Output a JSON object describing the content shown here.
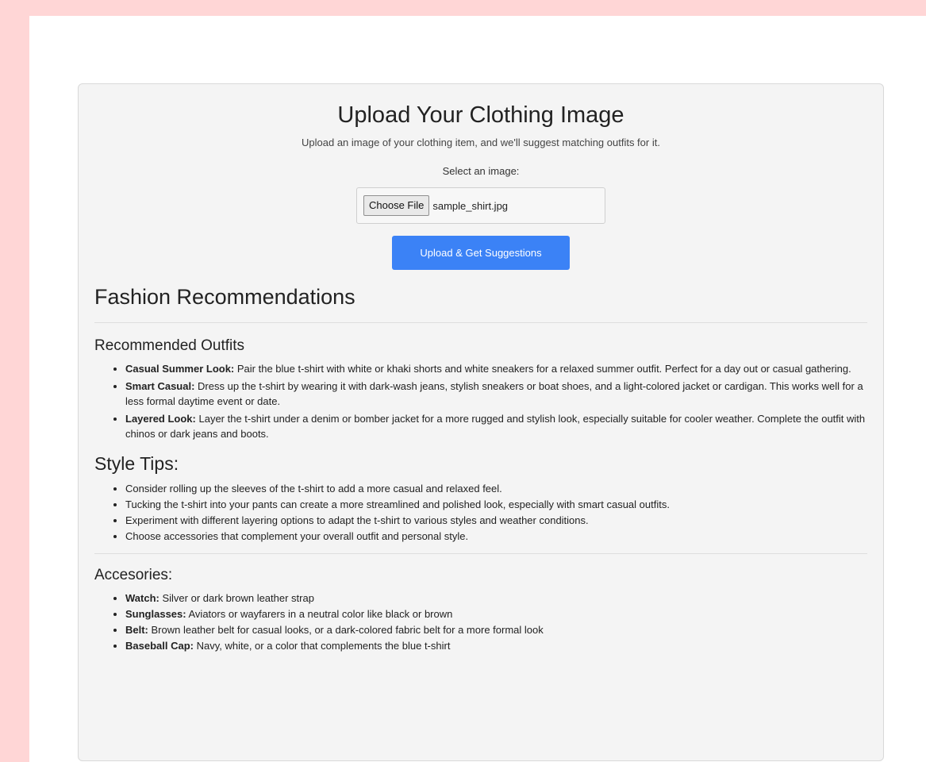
{
  "upload": {
    "title": "Upload Your Clothing Image",
    "subtitle": "Upload an image of your clothing item, and we'll suggest matching outfits for it.",
    "select_label": "Select an image:",
    "file_button_label": "Choose File",
    "file_name": "sample_shirt.jpg",
    "submit_label": "Upload & Get Suggestions"
  },
  "recommendations": {
    "heading": "Fashion Recommendations",
    "outfits_heading": "Recommended Outfits",
    "outfits": [
      {
        "name": "Casual Summer Look:",
        "text": "Pair the blue t-shirt with white or khaki shorts and white sneakers for a relaxed summer outfit. Perfect for a day out or casual gathering."
      },
      {
        "name": "Smart Casual:",
        "text": "Dress up the t-shirt by wearing it with dark-wash jeans, stylish sneakers or boat shoes, and a light-colored jacket or cardigan. This works well for a less formal daytime event or date."
      },
      {
        "name": "Layered Look:",
        "text": "Layer the t-shirt under a denim or bomber jacket for a more rugged and stylish look, especially suitable for cooler weather. Complete the outfit with chinos or dark jeans and boots."
      }
    ],
    "tips_heading": "Style Tips:",
    "tips": [
      "Consider rolling up the sleeves of the t-shirt to add a more casual and relaxed feel.",
      "Tucking the t-shirt into your pants can create a more streamlined and polished look, especially with smart casual outfits.",
      "Experiment with different layering options to adapt the t-shirt to various styles and weather conditions.",
      "Choose accessories that complement your overall outfit and personal style."
    ],
    "accessories_heading": "Accesories:",
    "accessories": [
      {
        "name": "Watch:",
        "text": "Silver or dark brown leather strap"
      },
      {
        "name": "Sunglasses:",
        "text": "Aviators or wayfarers in a neutral color like black or brown"
      },
      {
        "name": "Belt:",
        "text": "Brown leather belt for casual looks, or a dark-colored fabric belt for a more formal look"
      },
      {
        "name": "Baseball Cap:",
        "text": "Navy, white, or a color that complements the blue t-shirt"
      }
    ]
  },
  "colors": {
    "background": "#ffd6d6",
    "card": "#f4f4f4",
    "primary_button": "#3b82f6"
  }
}
